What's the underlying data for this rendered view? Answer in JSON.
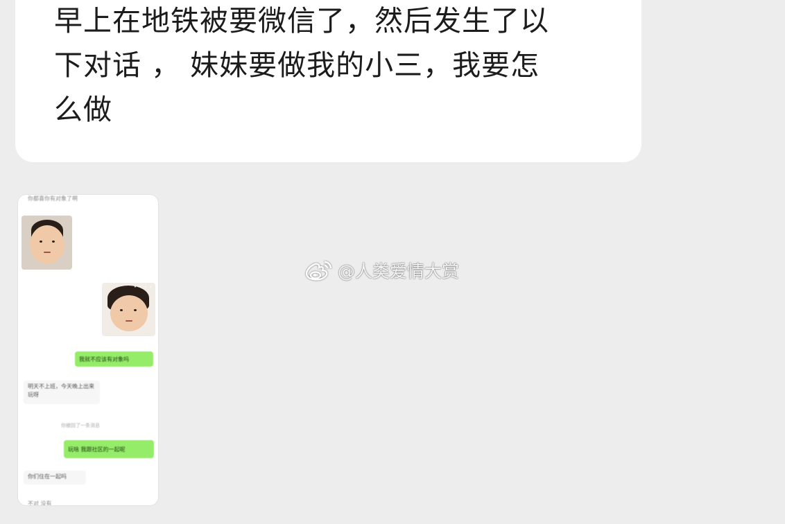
{
  "message": {
    "lines": [
      "早上在地铁被要微信了，然后发生了以",
      "下对话 ， 妹妹要做我的小三，我要怎",
      "么做"
    ]
  },
  "screenshot_thumbnail": {
    "top_text": "你都喜你有对象了啊",
    "sent_green_1": "我就不应该有对象吗",
    "received_1": "明天不上班，今天晚上出来玩呀",
    "system_note": "你撤回了一条消息",
    "sent_green_2": "玩啥 我跟社区的一起呢",
    "received_2": "你们住在一起吗",
    "bottom_text": "不对 没有"
  },
  "watermark": {
    "logo": "weibo-icon",
    "text": "@人类爱情大赏"
  }
}
